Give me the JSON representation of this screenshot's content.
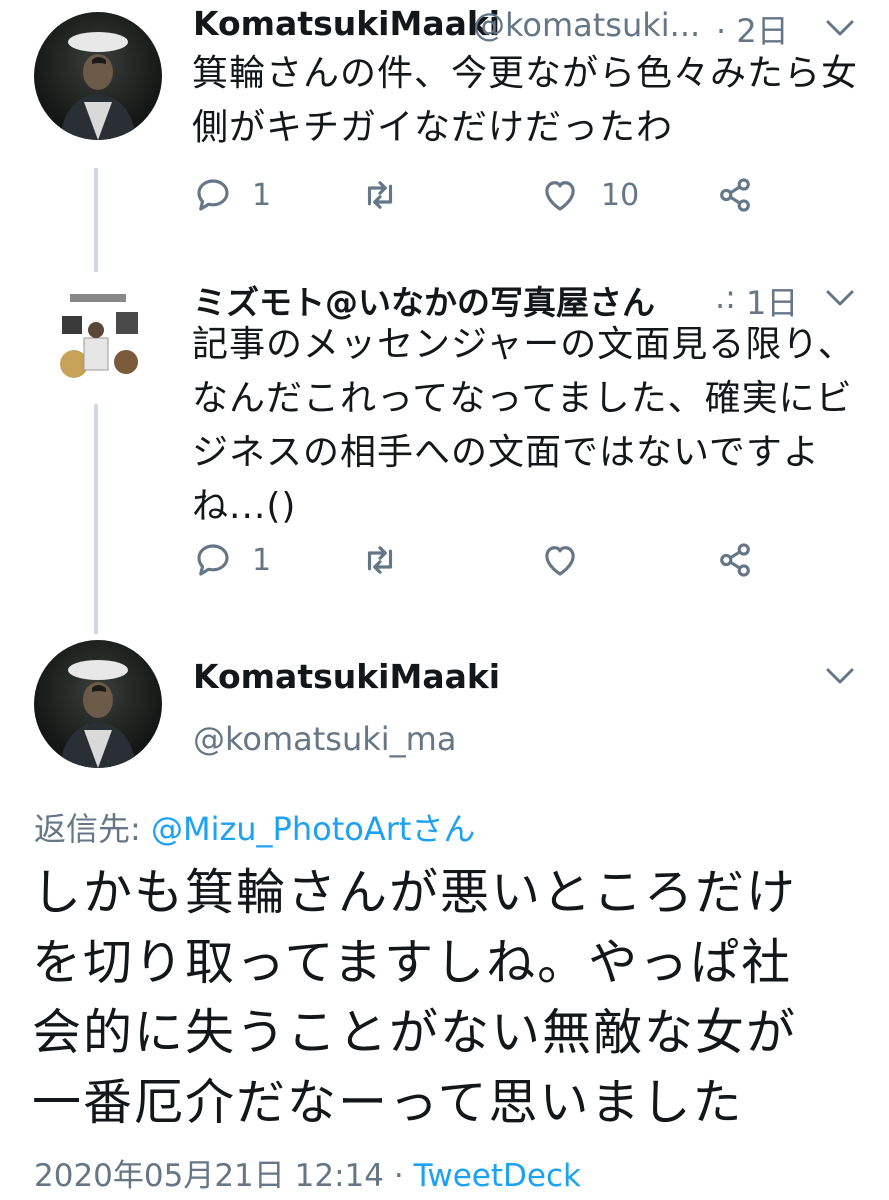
{
  "tweet1": {
    "display_name": "KomatsukiMaaki",
    "handle": "@komatsuki...",
    "time": "· 2日",
    "text_lines": [
      "箕輪さんの件、今更ながら色々みたら女",
      "側がキチガイなだけだったわ"
    ],
    "reply_count": "1",
    "like_count": "10"
  },
  "tweet2": {
    "display_name": "ミズモト@いなかの写真屋さん",
    "handle_abbrev": ".:",
    "time": "1日",
    "text_lines": [
      "記事のメッセンジャーの文面見る限り、",
      "なんだこれってなってました、確実にビ",
      "ジネスの相手への文面ではないですよ",
      "ね...()"
    ],
    "reply_count": "1"
  },
  "main_tweet": {
    "display_name": "KomatsukiMaaki",
    "handle": "@komatsuki_ma",
    "reply_to_label": "返信先:",
    "reply_to_handle": "@Mizu_PhotoArtさん",
    "text_lines": [
      "しかも箕輪さんが悪いところだけ",
      "を切り取ってますしね。やっぱ社",
      "会的に失うことがない無敵な女が",
      "一番厄介だなーって思いました"
    ],
    "timestamp": "2020年05月21日 12:14",
    "separator": "·",
    "client": "TweetDeck"
  },
  "icons": {
    "reply": "reply-icon",
    "retweet": "retweet-icon",
    "like": "heart-icon",
    "share": "share-icon",
    "menu": "chevron-down-icon"
  },
  "colors": {
    "muted": "#657786",
    "link": "#1da1f2",
    "thread_line": "#cfd9de"
  }
}
